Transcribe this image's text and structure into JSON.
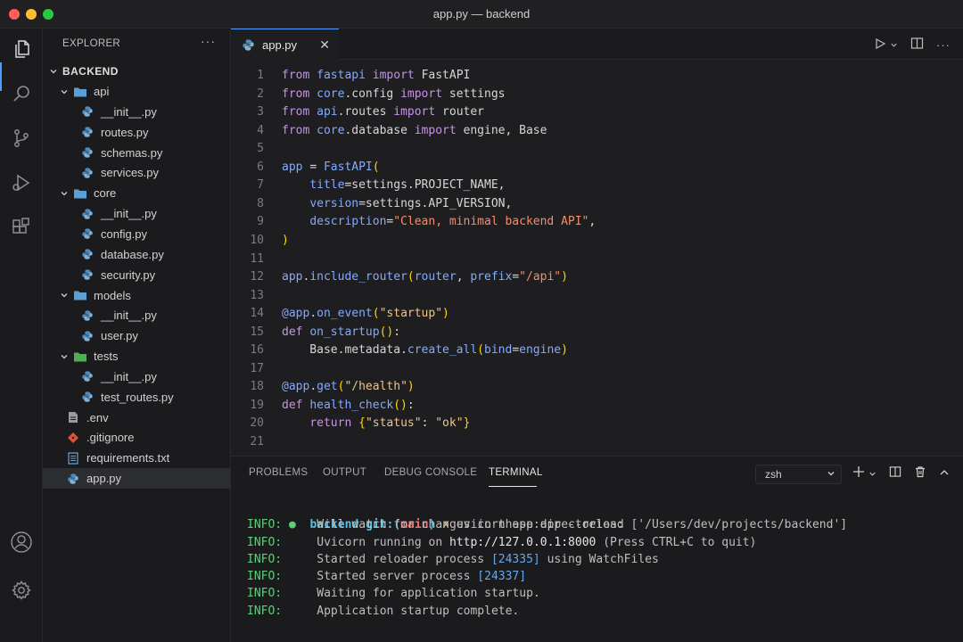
{
  "window": {
    "title": "app.py — backend"
  },
  "activity_bar": {
    "icons": [
      "files-icon",
      "search-icon",
      "source-control-icon",
      "run-debug-icon",
      "extensions-icon",
      "account-icon",
      "settings-gear-icon"
    ]
  },
  "explorer": {
    "title": "EXPLORER",
    "more": "···",
    "root": "BACKEND",
    "tree": [
      {
        "label": "api",
        "type": "folder",
        "depth": 1
      },
      {
        "label": "__init__.py",
        "type": "py",
        "depth": 2
      },
      {
        "label": "routes.py",
        "type": "py",
        "depth": 2
      },
      {
        "label": "schemas.py",
        "type": "py",
        "depth": 2
      },
      {
        "label": "services.py",
        "type": "py",
        "depth": 2
      },
      {
        "label": "core",
        "type": "folder",
        "depth": 1
      },
      {
        "label": "__init__.py",
        "type": "py",
        "depth": 2
      },
      {
        "label": "config.py",
        "type": "py",
        "depth": 2
      },
      {
        "label": "database.py",
        "type": "py",
        "depth": 2
      },
      {
        "label": "security.py",
        "type": "py",
        "depth": 2
      },
      {
        "label": "models",
        "type": "folder",
        "depth": 1
      },
      {
        "label": "__init__.py",
        "type": "py",
        "depth": 2
      },
      {
        "label": "user.py",
        "type": "py",
        "depth": 2
      },
      {
        "label": "tests",
        "type": "folder-green",
        "depth": 1
      },
      {
        "label": "__init__.py",
        "type": "py",
        "depth": 2
      },
      {
        "label": "test_routes.py",
        "type": "py",
        "depth": 2
      },
      {
        "label": ".env",
        "type": "file",
        "depth": 1
      },
      {
        "label": ".gitignore",
        "type": "git",
        "depth": 1
      },
      {
        "label": "requirements.txt",
        "type": "txt",
        "depth": 1
      },
      {
        "label": "app.py",
        "type": "py",
        "depth": 1,
        "selected": true
      }
    ]
  },
  "editor": {
    "tab": {
      "label": "app.py",
      "close": "✕"
    },
    "lines": [
      {
        "n": "1",
        "tokens": [
          [
            "kw",
            "from "
          ],
          [
            "fn",
            "fastapi "
          ],
          [
            "kw",
            "import "
          ],
          [
            "def",
            "FastAPI"
          ]
        ]
      },
      {
        "n": "2",
        "tokens": [
          [
            "kw",
            "from "
          ],
          [
            "fn",
            "core"
          ],
          [
            "def",
            ".config "
          ],
          [
            "kw",
            "import "
          ],
          [
            "def",
            "settings"
          ]
        ]
      },
      {
        "n": "3",
        "tokens": [
          [
            "kw",
            "from "
          ],
          [
            "fn",
            "api"
          ],
          [
            "def",
            ".routes "
          ],
          [
            "kw",
            "import "
          ],
          [
            "def",
            "router"
          ]
        ]
      },
      {
        "n": "4",
        "tokens": [
          [
            "kw",
            "from "
          ],
          [
            "fn",
            "core"
          ],
          [
            "def",
            ".database "
          ],
          [
            "kw",
            "import "
          ],
          [
            "def",
            "engine, Base"
          ]
        ]
      },
      {
        "n": "5",
        "tokens": []
      },
      {
        "n": "6",
        "tokens": [
          [
            "fn",
            "app "
          ],
          [
            "def",
            "= "
          ],
          [
            "fn",
            "FastAPI"
          ],
          [
            "paren",
            "("
          ]
        ]
      },
      {
        "n": "7",
        "tokens": [
          [
            "def",
            "    "
          ],
          [
            "fn",
            "title"
          ],
          [
            "def",
            "=settings.PROJECT_NAME,"
          ]
        ]
      },
      {
        "n": "8",
        "tokens": [
          [
            "def",
            "    "
          ],
          [
            "fn",
            "version"
          ],
          [
            "def",
            "=settings.API_VERSION,"
          ]
        ]
      },
      {
        "n": "9",
        "tokens": [
          [
            "def",
            "    "
          ],
          [
            "fn",
            "description"
          ],
          [
            "def",
            "="
          ],
          [
            "str",
            "\"Clean, minimal backend API\""
          ],
          [
            "def",
            ","
          ]
        ]
      },
      {
        "n": "10",
        "tokens": [
          [
            "paren",
            ")"
          ]
        ]
      },
      {
        "n": "11",
        "tokens": []
      },
      {
        "n": "12",
        "tokens": [
          [
            "fn",
            "app"
          ],
          [
            "def",
            "."
          ],
          [
            "fn",
            "include_router"
          ],
          [
            "paren",
            "("
          ],
          [
            "fn",
            "router"
          ],
          [
            "def",
            ", "
          ],
          [
            "fn",
            "prefix"
          ],
          [
            "def",
            "="
          ],
          [
            "str",
            "\"/api\""
          ],
          [
            "paren",
            ")"
          ]
        ]
      },
      {
        "n": "13",
        "tokens": []
      },
      {
        "n": "14",
        "tokens": [
          [
            "fn",
            "@app"
          ],
          [
            "def",
            "."
          ],
          [
            "fn",
            "on_event"
          ],
          [
            "paren",
            "("
          ],
          [
            "str2",
            "\"startup\""
          ],
          [
            "paren",
            ")"
          ]
        ]
      },
      {
        "n": "15",
        "tokens": [
          [
            "kw",
            "def "
          ],
          [
            "fn",
            "on_startup"
          ],
          [
            "paren",
            "()"
          ],
          [
            "def",
            ":"
          ]
        ]
      },
      {
        "n": "16",
        "tokens": [
          [
            "def",
            "    Base.metadata."
          ],
          [
            "fn",
            "create_all"
          ],
          [
            "paren",
            "("
          ],
          [
            "fn",
            "bind"
          ],
          [
            "def",
            "="
          ],
          [
            "fn",
            "engine"
          ],
          [
            "paren",
            ")"
          ]
        ]
      },
      {
        "n": "17",
        "tokens": []
      },
      {
        "n": "18",
        "tokens": [
          [
            "fn",
            "@app"
          ],
          [
            "def",
            "."
          ],
          [
            "fn",
            "get"
          ],
          [
            "paren",
            "("
          ],
          [
            "str2",
            "\"/health\""
          ],
          [
            "paren",
            ")"
          ]
        ]
      },
      {
        "n": "19",
        "tokens": [
          [
            "kw",
            "def "
          ],
          [
            "fn",
            "health_check"
          ],
          [
            "paren",
            "()"
          ],
          [
            "def",
            ":"
          ]
        ]
      },
      {
        "n": "20",
        "tokens": [
          [
            "def",
            "    "
          ],
          [
            "kw",
            "return "
          ],
          [
            "paren",
            "{"
          ],
          [
            "str2",
            "\"status\""
          ],
          [
            "def",
            ": "
          ],
          [
            "str2",
            "\"ok\""
          ],
          [
            "paren",
            "}"
          ]
        ]
      },
      {
        "n": "21",
        "tokens": []
      }
    ]
  },
  "panel": {
    "tabs": [
      "PROBLEMS",
      "OUTPUT",
      "DEBUG CONSOLE",
      "TERMINAL"
    ],
    "active_tab": "TERMINAL",
    "shell": "zsh",
    "terminal": {
      "prompt": {
        "bullet": "●",
        "dir": "backend",
        "git": "git:(",
        "branch": "main",
        "git_close": ")",
        "x": "✗",
        "cmd": "uvicorn app:app --reload"
      },
      "lines": [
        {
          "level": "INFO:",
          "parts": [
            [
              "text",
              "Will watch for changes in these directories: ['/Users/dev/projects/backend']"
            ]
          ]
        },
        {
          "level": "INFO:",
          "parts": [
            [
              "text",
              "Uvicorn running on "
            ],
            [
              "link",
              "http://127.0.0.1:8000"
            ],
            [
              "text",
              " (Press CTRL+C to quit)"
            ]
          ]
        },
        {
          "level": "INFO:",
          "parts": [
            [
              "text",
              "Started reloader process "
            ],
            [
              "pid",
              "[24335]"
            ],
            [
              "text",
              " using WatchFiles"
            ]
          ]
        },
        {
          "level": "INFO:",
          "parts": [
            [
              "text",
              "Started server process "
            ],
            [
              "pid",
              "[24337]"
            ]
          ]
        },
        {
          "level": "INFO:",
          "parts": [
            [
              "text",
              "Waiting for application startup."
            ]
          ]
        },
        {
          "level": "INFO:",
          "parts": [
            [
              "text",
              "Application startup complete."
            ]
          ]
        }
      ]
    }
  },
  "colors": {
    "accent": "#4a9eff",
    "python": "#4b8bbe",
    "folder": "#5c9fd6",
    "folder_tests": "#4caf50",
    "git": "#e0533b"
  }
}
